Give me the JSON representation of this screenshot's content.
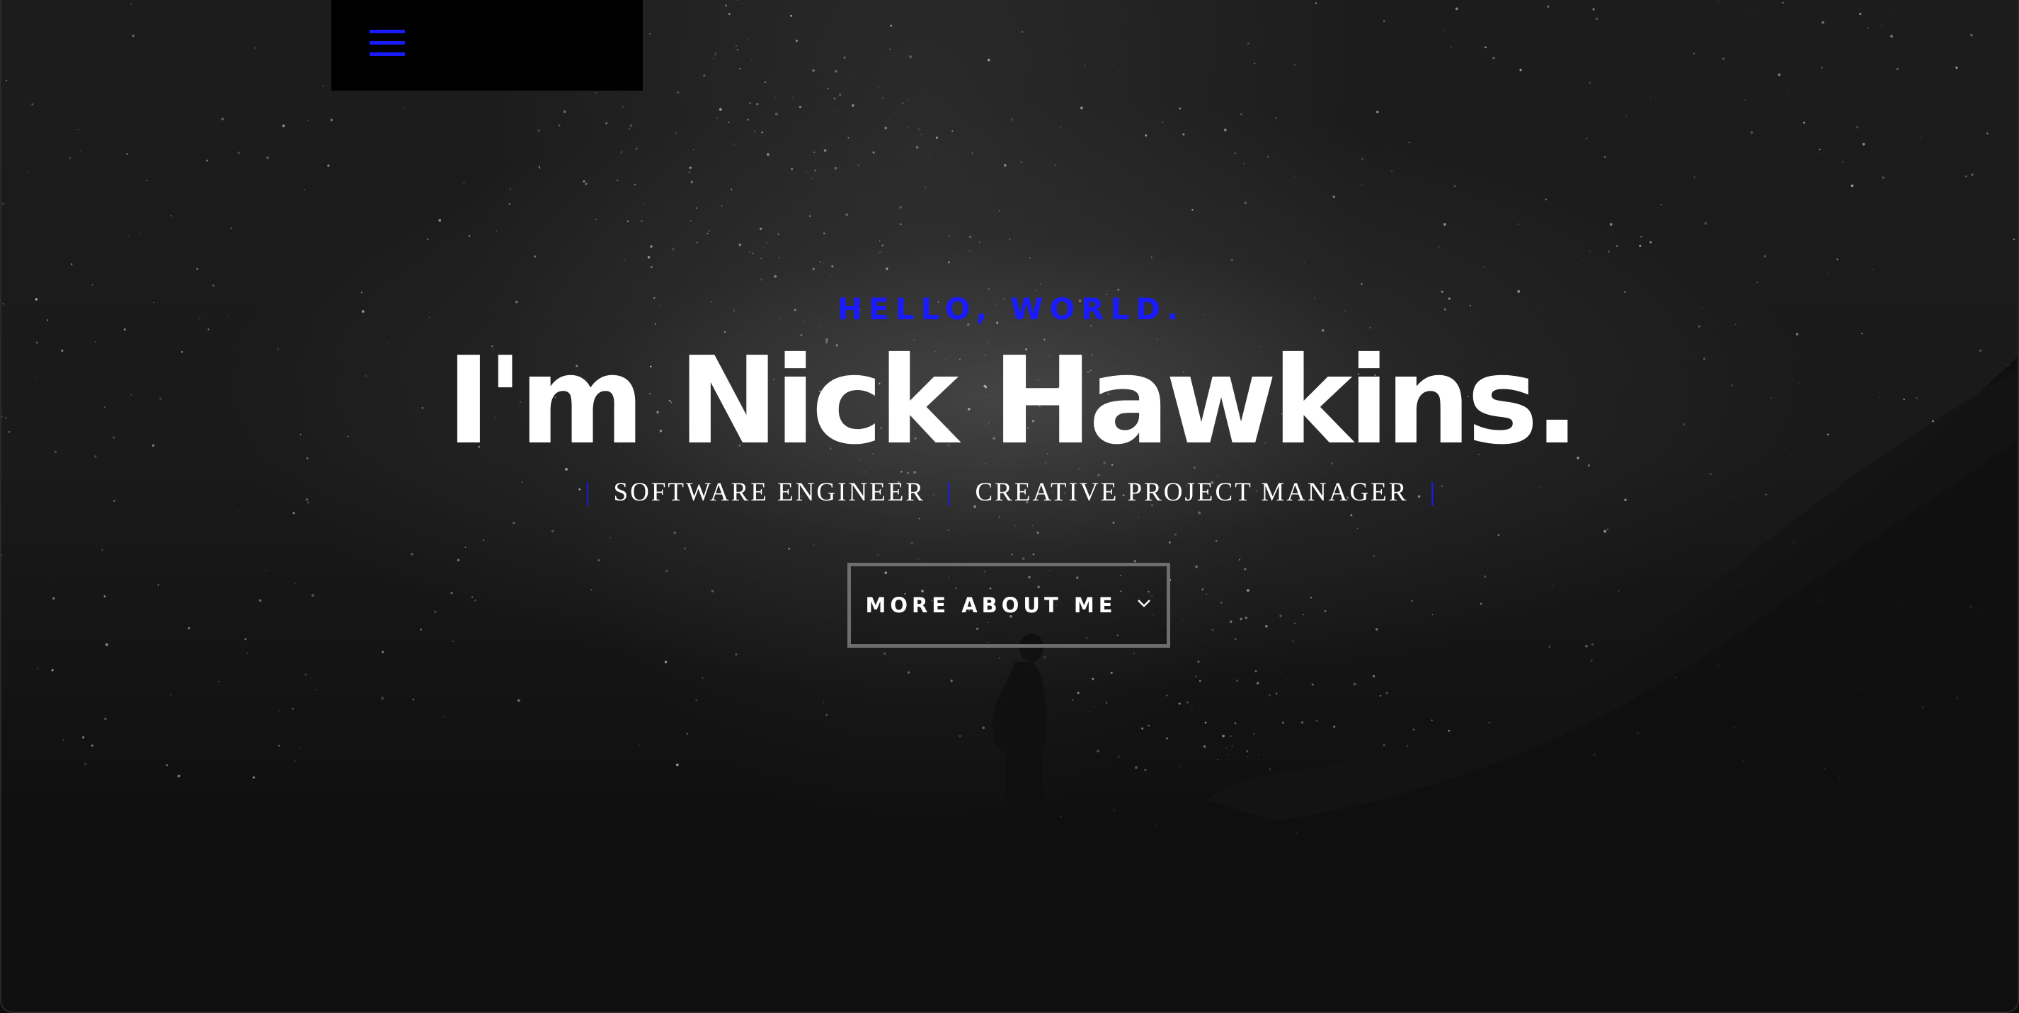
{
  "menu": {
    "icon": "hamburger-menu-icon",
    "accent_color": "#1a1aff"
  },
  "hero": {
    "kicker": "HELLO, WORLD.",
    "headline": "I'm Nick Hawkins.",
    "roles": [
      "SOFTWARE ENGINEER",
      "CREATIVE PROJECT MANAGER"
    ],
    "separator": "|",
    "cta_label": "MORE ABOUT ME",
    "cta_icon": "chevron-down-icon"
  },
  "colors": {
    "accent": "#1a1aff",
    "text": "#ffffff",
    "background": "#111111"
  }
}
